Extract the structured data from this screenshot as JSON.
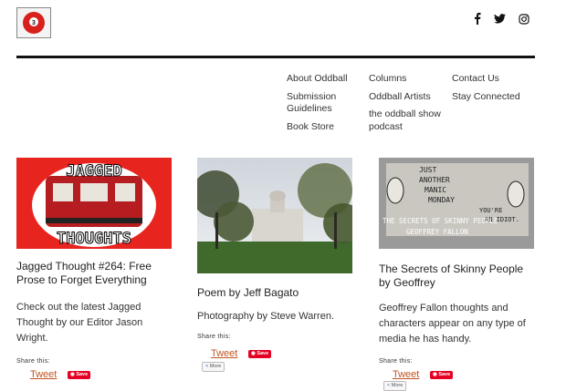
{
  "header": {
    "logo_icon": "billiard-3-ball",
    "social": [
      {
        "icon": "facebook-icon",
        "glyph": "f"
      },
      {
        "icon": "twitter-icon",
        "glyph": "🐦"
      },
      {
        "icon": "instagram-icon",
        "glyph": "◎"
      }
    ]
  },
  "nav": {
    "col1": [
      "About Oddball",
      "Submission Guidelines",
      "Book Store"
    ],
    "col2": [
      "Columns",
      "Oddball Artists",
      "the oddball show podcast"
    ],
    "col3": [
      "Contact Us",
      "Stay Connected"
    ]
  },
  "cards": [
    {
      "image_text_top": "JAGGED",
      "image_text_bottom": "THOUGHTS",
      "title": "Jagged Thought #264: Free Prose to Forget Everything",
      "desc": "Check out the latest Jagged Thought by our Editor Jason Wright.",
      "share": "Share this:",
      "tweet": "Tweet",
      "save": "Save",
      "more": "More"
    },
    {
      "title": "Poem by Jeff Bagato",
      "desc": "Photography by Steve Warren.",
      "share": "Share this:",
      "tweet": "Tweet",
      "save": "Save",
      "more": "More"
    },
    {
      "image_caption_1": "THE SECRETS OF SKINNY PEOPLE",
      "image_caption_2": "GEOFFREY FALLON",
      "title": "The Secrets of Skinny People by Geoffrey",
      "desc": "Geoffrey Fallon thoughts and characters appear on any type of media he has handy.",
      "share": "Share this:",
      "tweet": "Tweet",
      "save": "Save",
      "more": "More"
    }
  ],
  "colors": {
    "accent": "#c05522",
    "pinterest": "#e60023",
    "rule": "#111111"
  }
}
